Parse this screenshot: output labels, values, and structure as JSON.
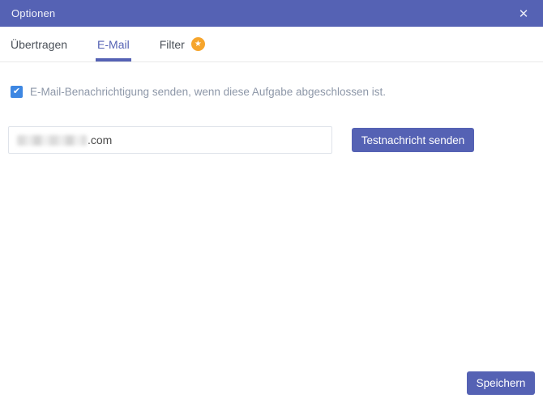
{
  "accent_color": "#5562b4",
  "checkbox_color": "#3e87e2",
  "badge_color": "#f6a52c",
  "icons": {
    "close": "✕",
    "check": "✔",
    "star": "★"
  },
  "header": {
    "title": "Optionen"
  },
  "tabs": [
    {
      "label": "Übertragen",
      "active": false
    },
    {
      "label": "E-Mail",
      "active": true
    },
    {
      "label": "Filter",
      "active": false,
      "has_badge": true
    }
  ],
  "email_section": {
    "checkbox_checked": true,
    "checkbox_label": "E-Mail-Benachrichtigung senden, wenn diese Aufgabe abgeschlossen ist.",
    "email_redacted": true,
    "email_visible_part": ".com",
    "test_button_label": "Testnachricht senden"
  },
  "footer": {
    "save_label": "Speichern"
  }
}
